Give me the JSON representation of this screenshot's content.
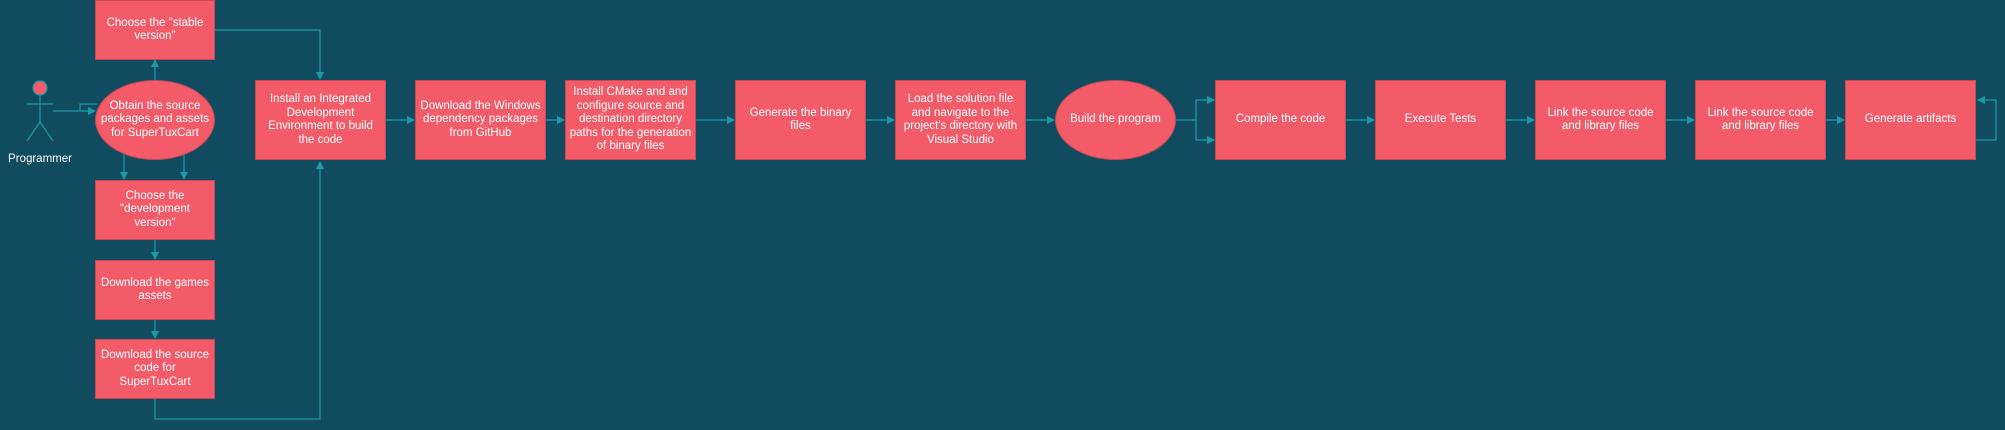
{
  "diagram": {
    "actor": {
      "label": "Programmer"
    },
    "nodes": {
      "choose_stable": "Choose the \"stable version\"",
      "obtain_sources": "Obtain the source packages and assets for SuperTuxCart",
      "choose_dev": "Choose the \"development version\"",
      "download_assets": "Download the games assets",
      "download_source": "Download the source code for SuperTuxCart",
      "install_ide": "Install an Integrated Development Environment to build the code",
      "download_deps": "Download the Windows dependency packages from GitHub",
      "install_cmake": "Install CMake and and configure source and destination directory paths for the generation of binary files",
      "generate_binary": "Generate the binary files",
      "load_solution": "Load the solution file and navigate to the project's directory with Visual Studio",
      "build_program": "Build the program",
      "compile_code": "Compile the code",
      "execute_tests": "Execute Tests",
      "link_1": "Link the source code and library files",
      "link_2": "Link the source code and library files",
      "generate_artifacts": "Generate artifacts"
    },
    "colors": {
      "background": "#114b5f",
      "node_fill": "#f45b69",
      "node_text": "#ffffff",
      "connector": "#1a9ba6"
    }
  }
}
